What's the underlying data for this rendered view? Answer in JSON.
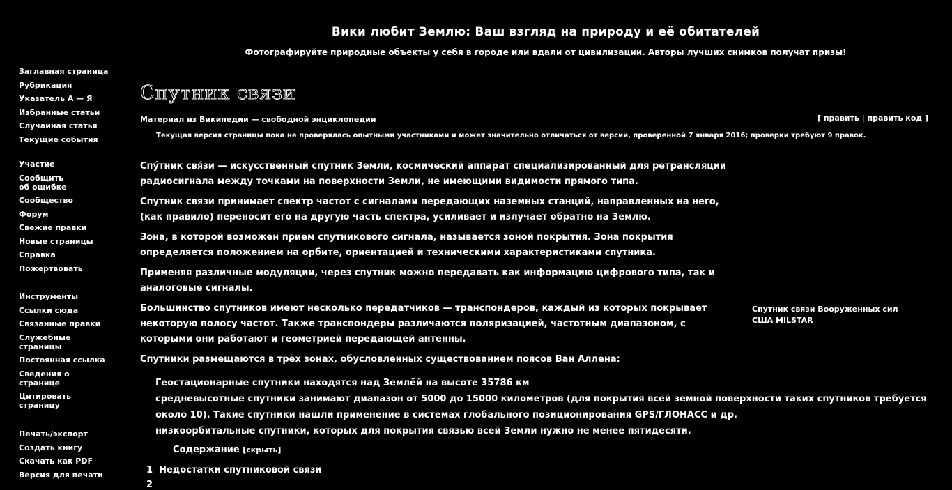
{
  "banner": {
    "title": "Вики любит Землю: Ваш взгляд на природу и её обитателей",
    "subtitle": "Фотографируйте природные объекты у себя в городе или вдали от цивилизации. Авторы лучших снимков получат призы!"
  },
  "sidebar": {
    "nav": [
      "Заглавная страница",
      "Рубрикация",
      "Указатель А — Я",
      "Избранные статьи",
      "Случайная статья",
      "Текущие события"
    ],
    "participation_heading": "Участие",
    "participation": [
      "Сообщить об ошибке",
      "Сообщество",
      "Форум",
      "Свежие правки",
      "Новые страницы",
      "Справка",
      "Пожертвовать"
    ],
    "tools_heading": "Инструменты",
    "tools": [
      "Ссылки сюда",
      "Связанные правки",
      "Служебные страницы",
      "Постоянная ссылка",
      "Сведения о странице",
      "Цитировать страницу"
    ],
    "print_heading": "Печать/экспорт",
    "print": [
      "Создать книгу",
      "Скачать как PDF",
      "Версия для печати"
    ]
  },
  "article": {
    "title": "Спутник связи",
    "tagline": "Материал из Википедии — свободной энциклопедии",
    "edit_link": "[ править | править код ]",
    "flagged_notice": "Текущая версия страницы пока не проверялась опытными участниками и может значительно отличаться от версии, проверенной 7 января 2016; проверки требуют 9 правок.",
    "lead_term": "Спу́тник свя́зи",
    "paragraphs": [
      " — искусственный спутник Земли, космический аппарат специализированный для ретрансляции радиосигнала между точками на поверхности Земли, не имеющими видимости прямого типа.",
      "Спутник связи принимает спектр частот с сигналами передающих наземных станций, направленных на него, (как правило) переносит его на другую часть спектра, усиливает и излучает обратно на Землю.",
      "Зона, в которой возможен прием спутникового сигнала, называется зоной покрытия. Зона покрытия определяется положением на орбите, ориентацией и техническими характеристиками спутника.",
      "Применяя различные модуляции, через спутник можно передавать как информацию цифрового типа, так и аналоговые сигналы.",
      "Большинство спутников имеют несколько передатчиков — транспондеров, каждый из которых покрывает некоторую полосу частот. Также транспондеры различаются поляризацией, частотным диапазоном, с которыми они работают и геометрией передающей антенны.",
      "Спутники размещаются в трёх зонах, обусловленных существованием поясов Ван Аллена:"
    ],
    "zones": [
      "Геостационарные спутники находятся над Землёй на высоте 35786 км",
      "средневысотные спутники занимают диапазон от 5000 до 15000 километров (для покрытия всей земной поверхности таких спутников требуется около 10). Такие спутники нашли применение в системах глобального позиционирования GPS/ГЛОНАСС и др.",
      "низкоорбитальные спутники, которых для покрытия связью всей Земли нужно не менее пятидесяти."
    ],
    "thumb_caption": "Спутник связи Вооруженных сил США MILSTAR"
  },
  "toc": {
    "title": "Содержание",
    "toggle": "[скрыть]",
    "items": [
      {
        "num": "1",
        "label": "Недостатки спутниковой связи"
      },
      {
        "num": "2",
        "label": ""
      }
    ]
  }
}
